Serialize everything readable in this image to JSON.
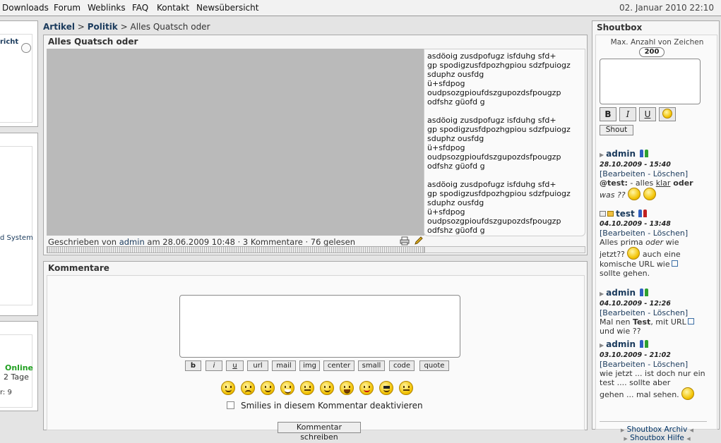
{
  "topnav": {
    "items": [
      "Downloads",
      "Forum",
      "Weblinks",
      "FAQ",
      "Kontakt",
      "Newsübersicht"
    ],
    "datetime": "02. Januar 2010 22:10"
  },
  "left": {
    "box1_text": "richt",
    "box2_text": "d System",
    "box3_online": "Online",
    "box3_days": "2 Tage",
    "box3_count": "r: 9"
  },
  "breadcrumb": {
    "level1": "Artikel",
    "sep": ">",
    "level2": "Politik",
    "current": "Alles Quatsch oder"
  },
  "article": {
    "title": "Alles Quatsch oder",
    "paragraphs": [
      "asdöoig zusdpofugz isfduhg sfd+\ngp spodigzusfdpozhgpiou sdzfpuiogz\nsduphz ousfdg\nü+sfdpog\noudpsozgpioufdszgupozdsfpougzp\nodfshz güofd g",
      "asdöoig zusdpofugz isfduhg sfd+\ngp spodigzusfdpozhgpiou sdzfpuiogz\nsduphz ousfdg\nü+sfdpog\noudpsozgpioufdszgupozdsfpougzp\nodfshz güofd g",
      "asdöoig zusdpofugz isfduhg sfd+\ngp spodigzusfdpozhgpiou sdzfpuiogz\nsduphz ousfdg\nü+sfdpog\noudpsozgpioufdszgupozdsfpougzp\nodfshz güofd g"
    ],
    "byline_prefix": "Geschrieben von",
    "author": "admin",
    "byline_date": "am 28.06.2009 10:48",
    "comments": "· 3 Kommentare",
    "reads": "· 76 gelesen"
  },
  "comment_form": {
    "title": "Kommentare",
    "bbcode_buttons": [
      "b",
      "i",
      "u",
      "url",
      "mail",
      "img",
      "center",
      "small",
      "code",
      "quote"
    ],
    "smilies": [
      "smile",
      "sad",
      "wink",
      "grin",
      "confused",
      "smirk",
      "laugh",
      "tongue",
      "cool",
      "neutral"
    ],
    "disable_smilies_label": "Smilies in diesem Kommentar deaktivieren",
    "submit_label": "Kommentar schreiben"
  },
  "shoutbox": {
    "title": "Shoutbox",
    "max_label": "Max. Anzahl von Zeichen",
    "max_count": "200",
    "format_buttons": [
      "B",
      "I",
      "U"
    ],
    "shout_label": "Shout",
    "entries": [
      {
        "user": "admin",
        "date": "28.10.2009 - 15:40",
        "actions": "[Bearbeiten - Löschen]",
        "msg_a": "@test:",
        "msg_b": " - alles ",
        "msg_c": "klar",
        "msg_d": " oder",
        "msg_e": "was ??"
      },
      {
        "user": "test",
        "date": "04.10.2009 - 13:48",
        "actions": "[Bearbeiten - Löschen]",
        "msg_a": "Alles prima ",
        "msg_b": "oder",
        "msg_c": " wie",
        "msg_d": "jetzt??",
        "msg_e": " auch eine komische URL wie",
        "msg_f": "sollte gehen."
      },
      {
        "user": "admin",
        "date": "04.10.2009 - 12:26",
        "actions": "[Bearbeiten - Löschen]",
        "msg_a": "Mal nen ",
        "msg_b": "Test",
        "msg_c": ", mit URL",
        "msg_d": "und wie ??"
      },
      {
        "user": "admin",
        "date": "03.10.2009 - 21:02",
        "actions": "[Bearbeiten - Löschen]",
        "msg_a": "wie jetzt ... ist doch nur ein test .... sollte aber",
        "msg_b": "gehen ... mal sehen."
      }
    ],
    "archive_link": "Shoutbox Archiv",
    "help_link": "Shoutbox Hilfe"
  }
}
